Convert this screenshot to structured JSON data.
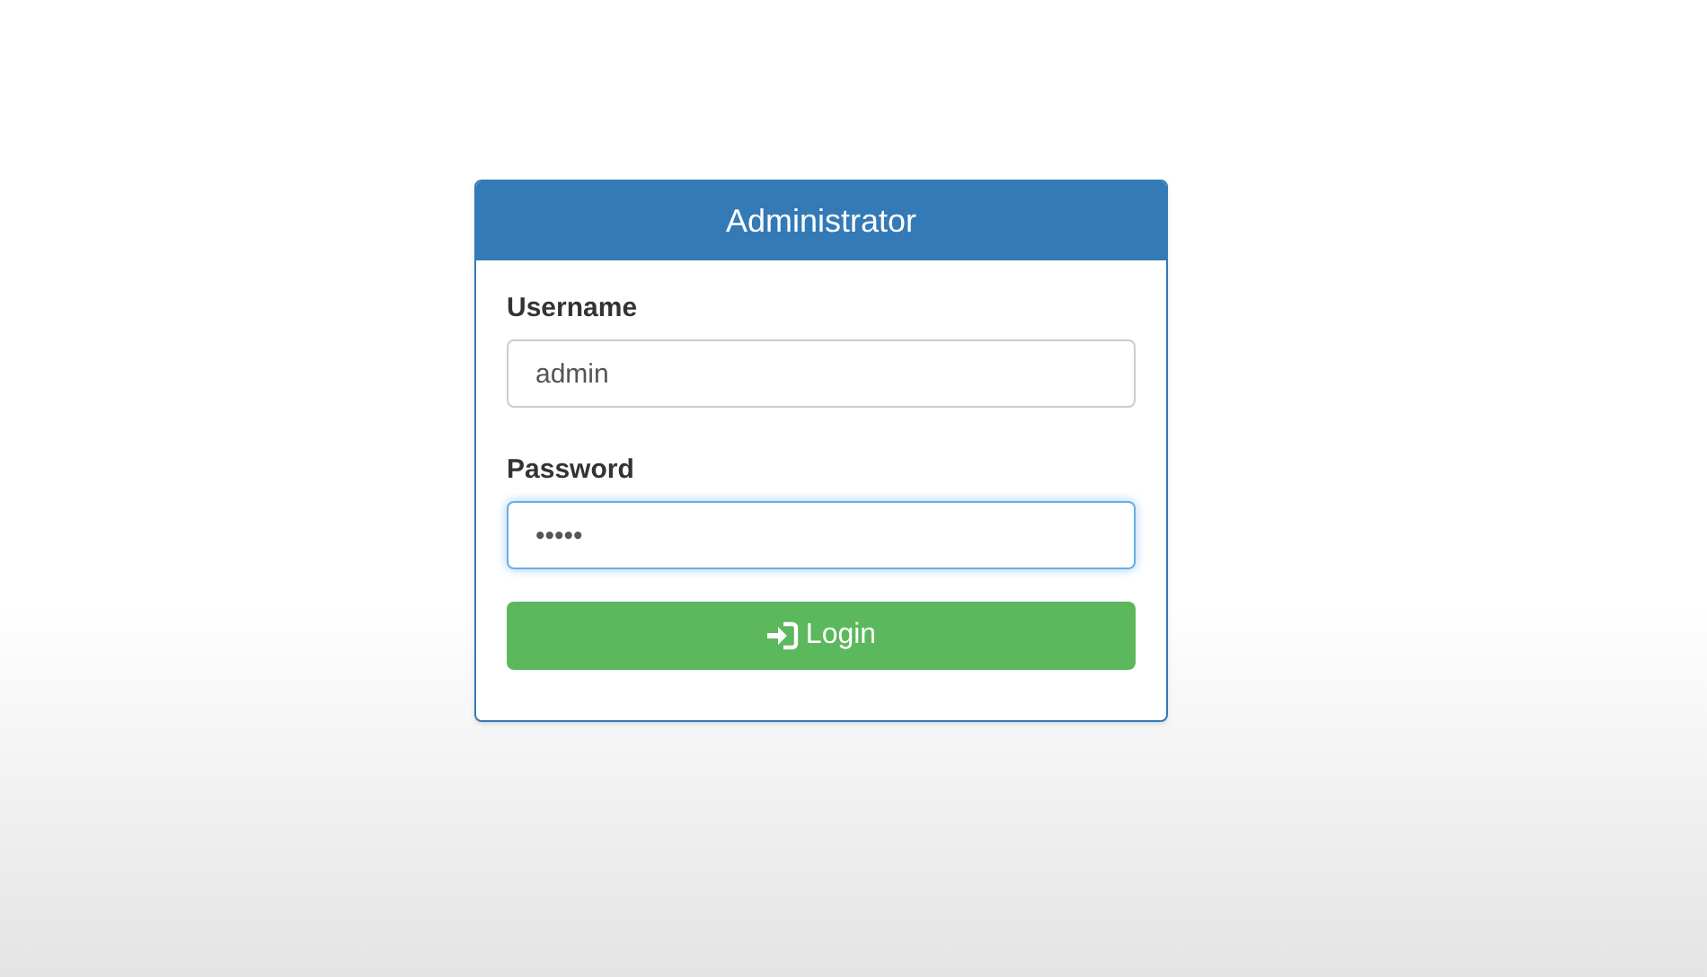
{
  "panel": {
    "title": "Administrator"
  },
  "fields": [
    {
      "label": "Username",
      "value": "admin",
      "focused": false
    },
    {
      "label": "Password",
      "value": "•••••",
      "focused": true
    }
  ],
  "login_button": {
    "label": "Login"
  }
}
